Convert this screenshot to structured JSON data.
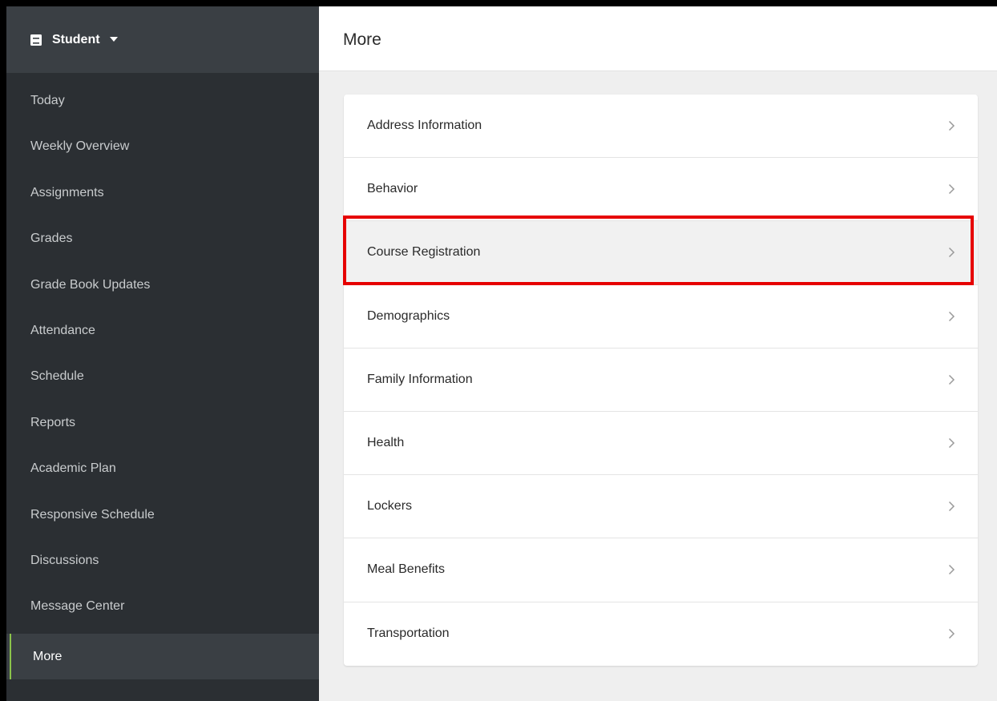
{
  "sidebar": {
    "switcher_label": "Student",
    "items": [
      {
        "label": "Today"
      },
      {
        "label": "Weekly Overview"
      },
      {
        "label": "Assignments"
      },
      {
        "label": "Grades"
      },
      {
        "label": "Grade Book Updates"
      },
      {
        "label": "Attendance"
      },
      {
        "label": "Schedule"
      },
      {
        "label": "Reports"
      },
      {
        "label": "Academic Plan"
      },
      {
        "label": "Responsive Schedule"
      },
      {
        "label": "Discussions"
      },
      {
        "label": "Message Center"
      },
      {
        "label": "More",
        "active": true
      }
    ]
  },
  "main": {
    "title": "More",
    "rows": [
      {
        "label": "Address Information"
      },
      {
        "label": "Behavior"
      },
      {
        "label": "Course Registration",
        "highlighted": true
      },
      {
        "label": "Demographics"
      },
      {
        "label": "Family Information"
      },
      {
        "label": "Health"
      },
      {
        "label": "Lockers"
      },
      {
        "label": "Meal Benefits"
      },
      {
        "label": "Transportation"
      }
    ]
  },
  "icons": {
    "switcher": "book-icon",
    "dropdown": "caret-down-icon",
    "row_arrow": "chevron-right-icon"
  },
  "colors": {
    "sidebar_bg": "#2b2f33",
    "sidebar_header_bg": "#3a3f44",
    "active_accent": "#8bc34a",
    "highlight_border": "#e60000"
  }
}
